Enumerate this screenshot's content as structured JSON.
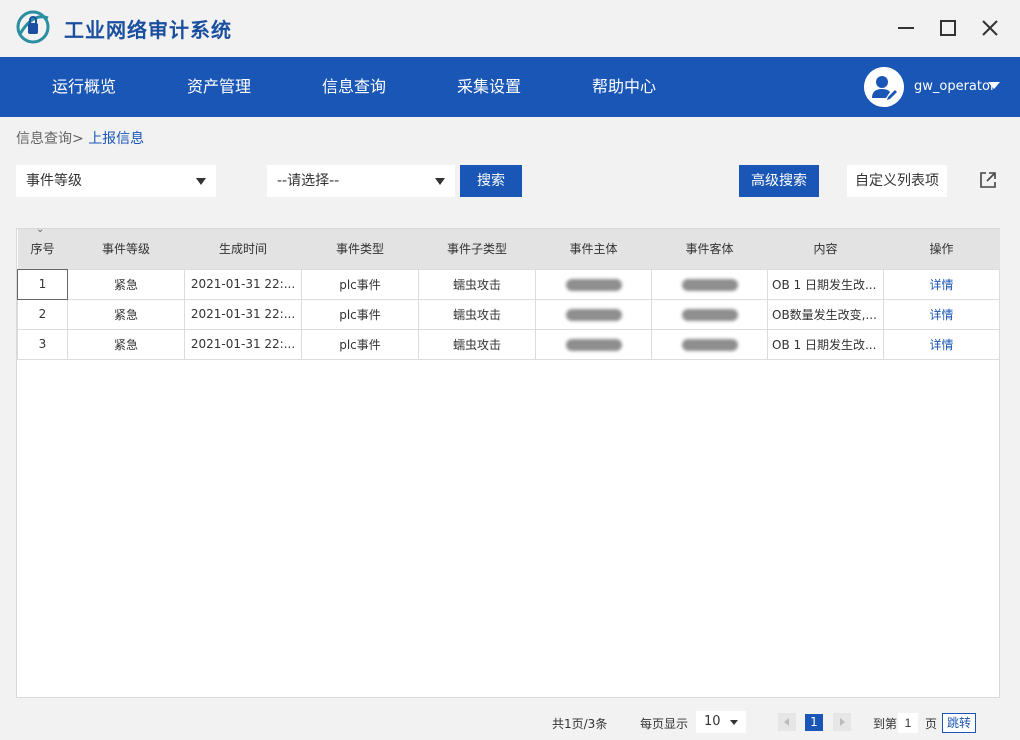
{
  "app": {
    "title": "工业网络审计系统"
  },
  "nav": {
    "items": [
      {
        "label": "运行概览"
      },
      {
        "label": "资产管理"
      },
      {
        "label": "信息查询"
      },
      {
        "label": "采集设置"
      },
      {
        "label": "帮助中心"
      }
    ],
    "username": "gw_operator"
  },
  "breadcrumb": {
    "parent": "信息查询>",
    "current": "上报信息"
  },
  "filters": {
    "field_select": "事件等级",
    "value_select": "--请选择--",
    "search_label": "搜索",
    "advanced_label": "高级搜索",
    "custom_columns_label": "自定义列表项"
  },
  "table": {
    "headers": [
      "序号",
      "事件等级",
      "生成时间",
      "事件类型",
      "事件子类型",
      "事件主体",
      "事件客体",
      "内容",
      "操作"
    ],
    "rows": [
      {
        "index": "1",
        "level": "紧急",
        "time": "2021-01-31 22:...",
        "type": "plc事件",
        "subtype": "蠕虫攻击",
        "content": "OB 1 日期发生改...",
        "action": "详情"
      },
      {
        "index": "2",
        "level": "紧急",
        "time": "2021-01-31 22:...",
        "type": "plc事件",
        "subtype": "蠕虫攻击",
        "content": "OB数量发生改变,...",
        "action": "详情"
      },
      {
        "index": "3",
        "level": "紧急",
        "time": "2021-01-31 22:...",
        "type": "plc事件",
        "subtype": "蠕虫攻击",
        "content": "OB 1 日期发生改...",
        "action": "详情"
      }
    ]
  },
  "pagination": {
    "summary": "共1页/3条",
    "per_page_label": "每页显示",
    "per_page_value": "10",
    "current_page": "1",
    "goto_label": "到第",
    "goto_value": "1",
    "page_unit": "页",
    "jump_label": "跳转"
  },
  "colors": {
    "brand": "#1a56b5",
    "background": "#f2f2f2"
  },
  "icons": [
    "app-logo-icon",
    "minimize-icon",
    "maximize-icon",
    "close-icon",
    "user-avatar-icon",
    "chevron-down-icon",
    "export-icon"
  ]
}
